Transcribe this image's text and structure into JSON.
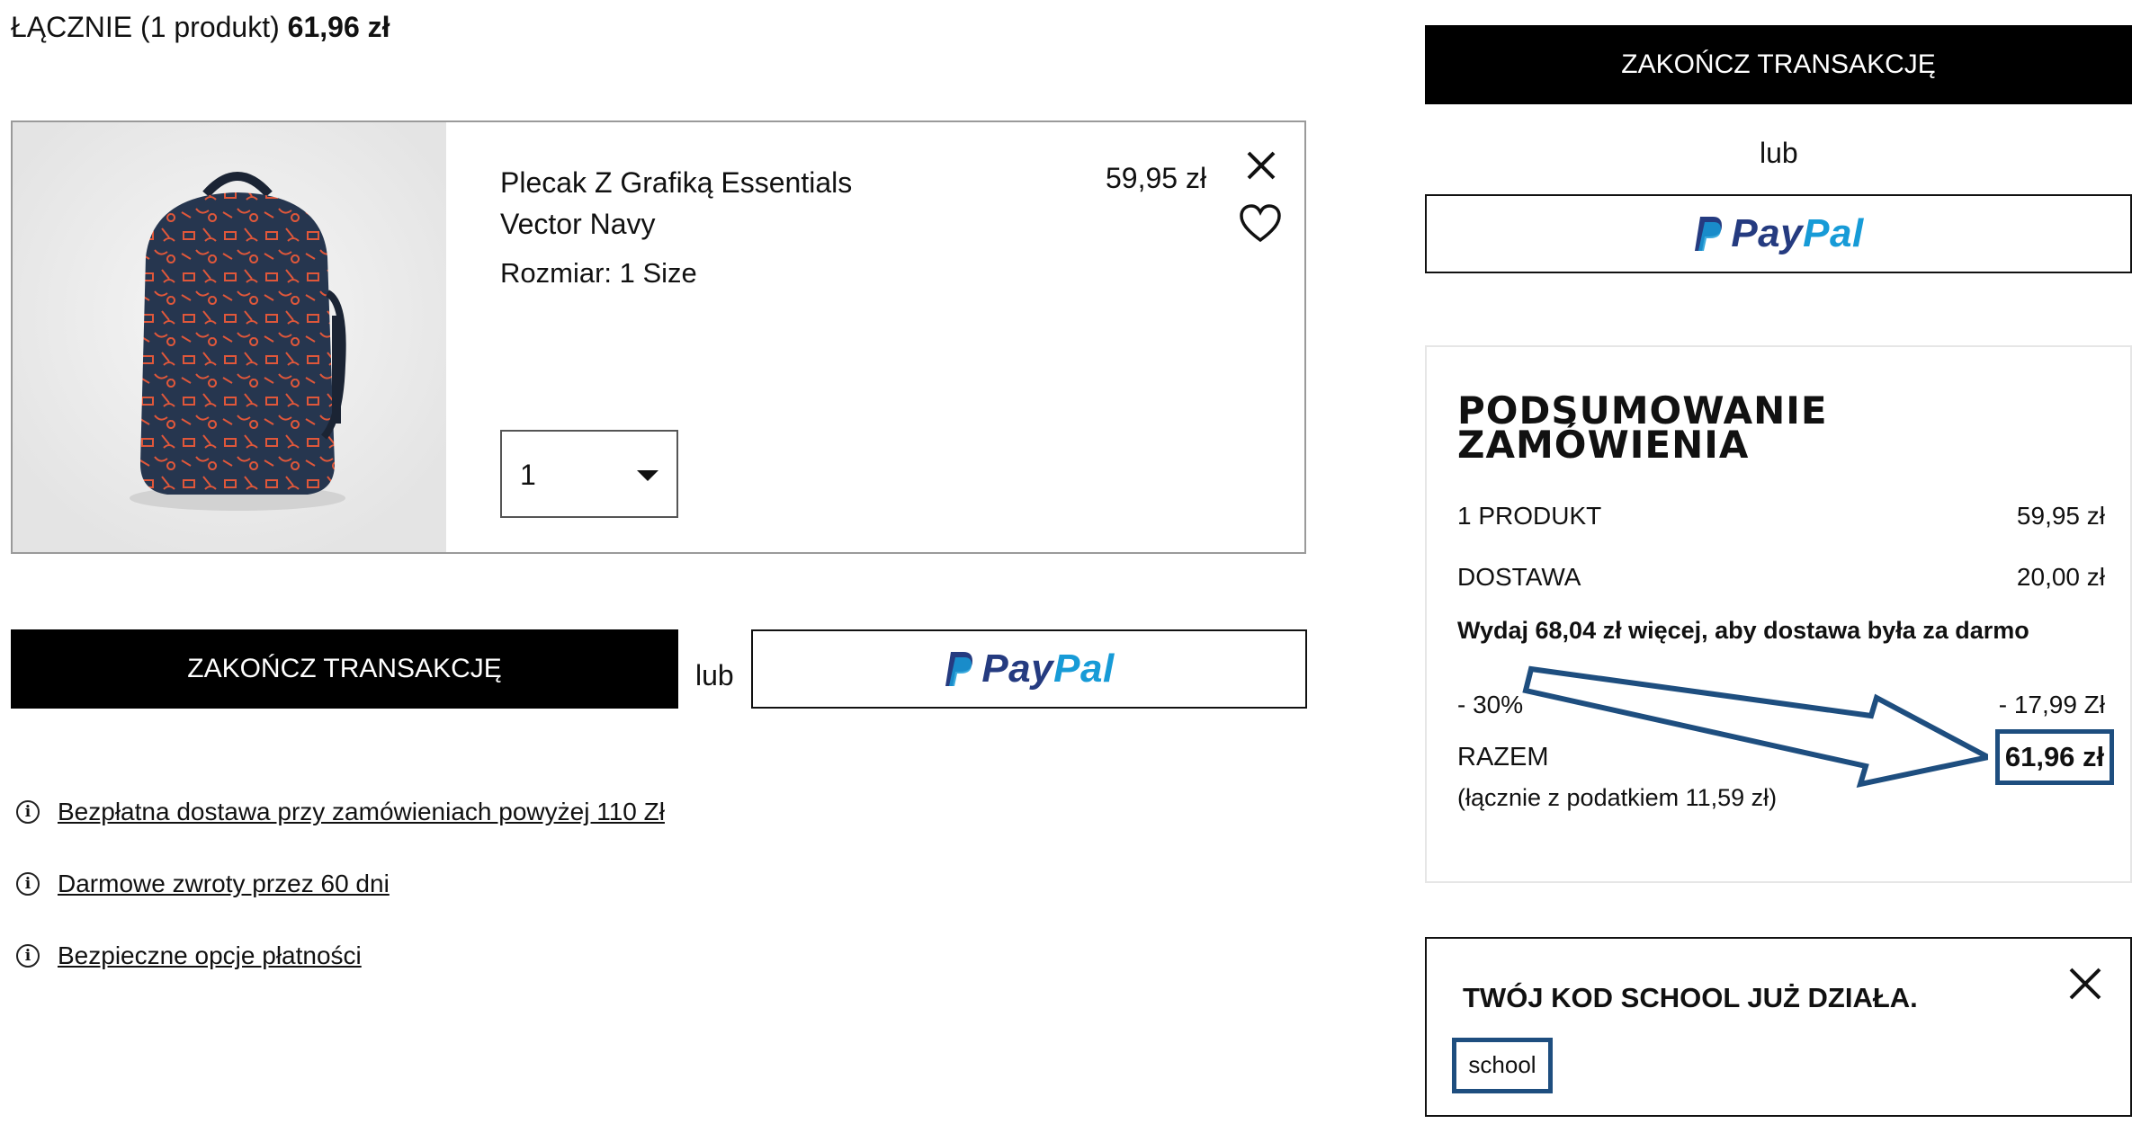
{
  "header": {
    "total_label": "ŁĄCZNIE (1 produkt)",
    "total_price": "61,96 zł"
  },
  "cart_item": {
    "name": "Plecak Z Grafiką Essentials Vector Navy",
    "price": "59,95 zł",
    "size_label": "Rozmiar: 1 Size",
    "quantity": "1",
    "remove_icon": "close-icon",
    "wishlist_icon": "heart-icon"
  },
  "actions": {
    "checkout_label": "ZAKOŃCZ TRANSAKCJĘ",
    "or_label": "lub",
    "paypal_pay": "Pay",
    "paypal_pal": "Pal"
  },
  "info_links": [
    {
      "icon": "info-icon",
      "label": "Bezpłatna dostawa przy zamówieniach powyżej 110 Zł"
    },
    {
      "icon": "info-icon",
      "label": "Darmowe zwroty przez 60 dni"
    },
    {
      "icon": "info-icon",
      "label": "Bezpieczne opcje płatności"
    }
  ],
  "summary": {
    "title": "PODSUMOWANIE ZAMÓWIENIA",
    "product_label": "1 PRODUKT",
    "product_value": "59,95 zł",
    "delivery_label": "DOSTAWA",
    "delivery_value": "20,00 zł",
    "free_shipping_msg": "Wydaj 68,04 zł więcej, aby dostawa była za darmo",
    "discount_label": "- 30%",
    "discount_value": "- 17,99 Zł",
    "total_label": "RAZEM",
    "total_value": "61,96 zł",
    "tax_note": "(łącznie z podatkiem  11,59 zł)"
  },
  "promo_code": {
    "message": "TWÓJ KOD SCHOOL JUŻ DZIAŁA.",
    "code": "school",
    "close_icon": "close-icon"
  },
  "colors": {
    "annotation": "#1e4e7f",
    "button": "#000000",
    "paypal_dark": "#253b80",
    "paypal_light": "#179bd7",
    "backpack": "#26364f",
    "pattern": "#e0573a"
  }
}
